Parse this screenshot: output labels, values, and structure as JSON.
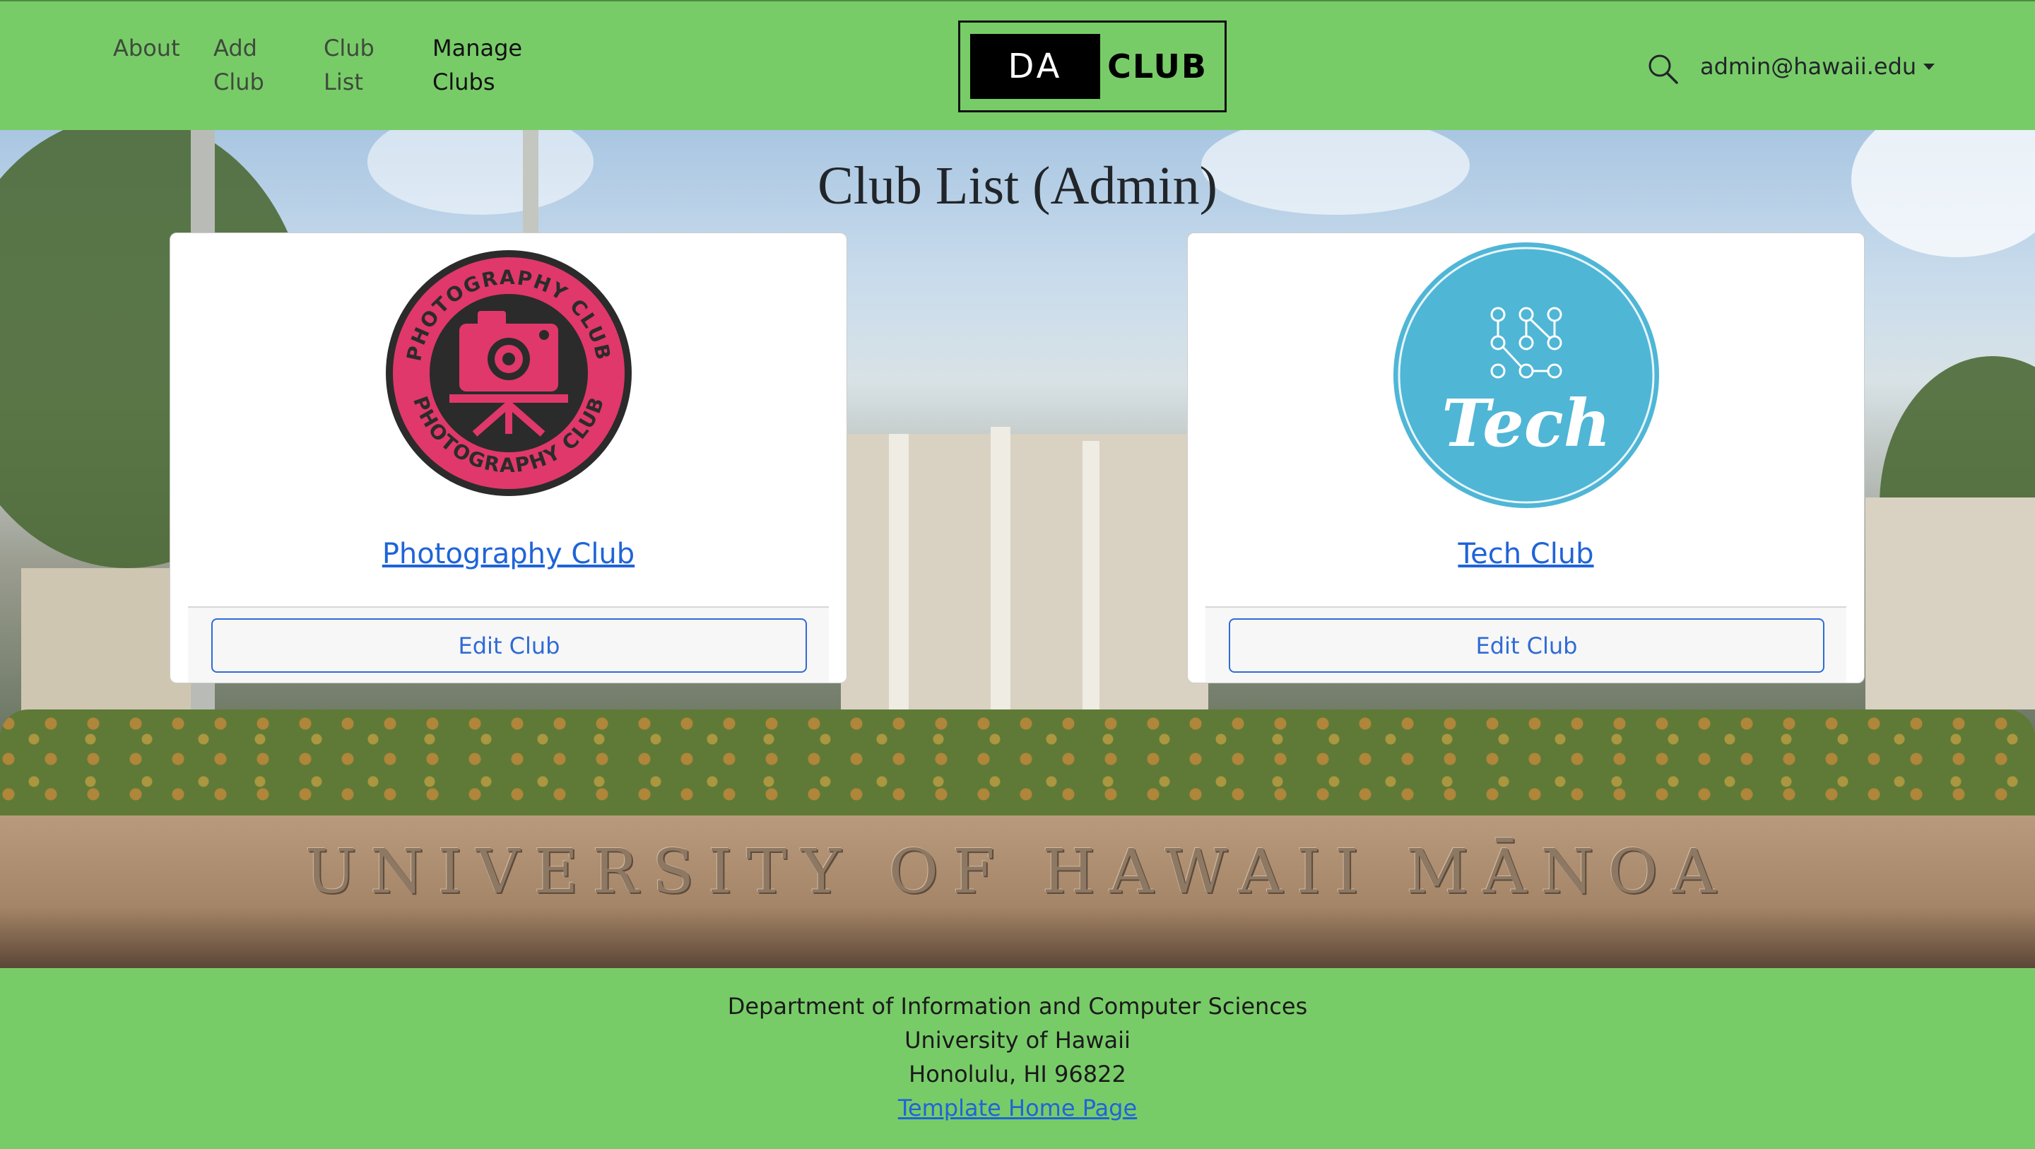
{
  "nav": {
    "links": [
      {
        "label": "About"
      },
      {
        "label": "Add\nClub"
      },
      {
        "label": "Club\nList"
      },
      {
        "label": "Manage\nClubs"
      }
    ],
    "brand": {
      "left": "DA",
      "right": "CLUB"
    },
    "search_icon": "search-icon",
    "user": "admin@hawaii.edu"
  },
  "hero": {
    "title": "Club List (Admin)",
    "sign_text": "UNIVERSITY OF HAWAII  MĀNOA"
  },
  "clubs": [
    {
      "name": "Photography Club",
      "logo_text": "PHOTOGRAPHY CLUB",
      "button": "Edit Club"
    },
    {
      "name": "Tech Club",
      "logo_text": "Tech",
      "button": "Edit Club"
    }
  ],
  "footer": {
    "line1": "Department of Information and Computer Sciences",
    "line2": "University of Hawaii",
    "line3": "Honolulu, HI 96822",
    "link": "Template Home Page"
  },
  "colors": {
    "nav_bg": "#78cc68",
    "link": "#1f64d8",
    "photo_logo": "#e0386a",
    "tech_logo": "#4fb6d6"
  }
}
